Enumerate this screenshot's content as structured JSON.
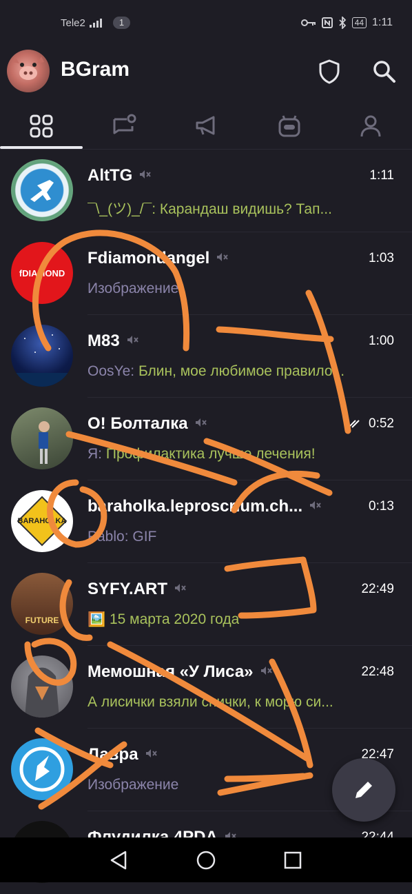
{
  "status_bar": {
    "carrier": "Tele2",
    "sim_badge": "1",
    "battery": "44",
    "time": "1:11"
  },
  "app_bar": {
    "title": "BGram"
  },
  "tabs": [
    {
      "icon": "all-chats-icon"
    },
    {
      "icon": "unread-chats-icon"
    },
    {
      "icon": "channels-icon"
    },
    {
      "icon": "bots-icon"
    },
    {
      "icon": "contacts-icon"
    }
  ],
  "chats": [
    {
      "name": "AltTG",
      "muted": true,
      "time": "1:11",
      "sender": "",
      "message": "¯\\_(ツ)_/¯: Карандаш видишь? Тап...",
      "message_color": "green",
      "avatar": "#3a8fd0"
    },
    {
      "name": "Fdiamondangel",
      "muted": true,
      "time": "1:03",
      "sender": "",
      "message": "Изображение",
      "message_color": "purple",
      "avatar_label": "fDIAMOND",
      "avatar": "#e2161b"
    },
    {
      "name": "M83",
      "muted": true,
      "time": "1:00",
      "sender": "OosYe: ",
      "message": "Блин, мое любимое правило...",
      "message_color": "green",
      "avatar": "#0d1b4a"
    },
    {
      "name": "О! Болталка",
      "muted": true,
      "time": "0:52",
      "read": true,
      "sender": "Я: ",
      "message": "Профилактика лучше лечения!",
      "message_color": "green",
      "avatar": "#4f5a48"
    },
    {
      "name": "baraholka.leproscrium.ch...",
      "muted": true,
      "time": "0:13",
      "sender": "Pablo: ",
      "message": "GIF",
      "message_color": "purple",
      "avatar_label": "BARAHOLKA",
      "avatar": "#ffffff"
    },
    {
      "name": "SYFY.ART",
      "muted": true,
      "time": "22:49",
      "sender": "",
      "message": "🖼️ 15 марта 2020 года",
      "message_color": "green",
      "avatar_label": "FUTURE",
      "avatar": "#6b3b2a"
    },
    {
      "name": "Мемошная «У Лиса»",
      "muted": true,
      "time": "22:48",
      "sender": "",
      "message": "А лисички взяли спички, к морю си...",
      "message_color": "green",
      "avatar": "#6b6a70"
    },
    {
      "name": "Лавра",
      "muted": true,
      "time": "22:47",
      "sender": "",
      "message": "Изображение",
      "message_color": "purple",
      "avatar": "#2f9fe0"
    },
    {
      "name": "Флудилка 4PDA",
      "muted": true,
      "time": "22:44",
      "sender": "",
      "message": "",
      "message_color": "green",
      "avatar": "#111111"
    }
  ],
  "colors": {
    "background": "#1e1d25",
    "accent_green": "#a9c25c",
    "secondary_purple": "#8b84aa",
    "scribble_orange": "#f08a3c"
  }
}
